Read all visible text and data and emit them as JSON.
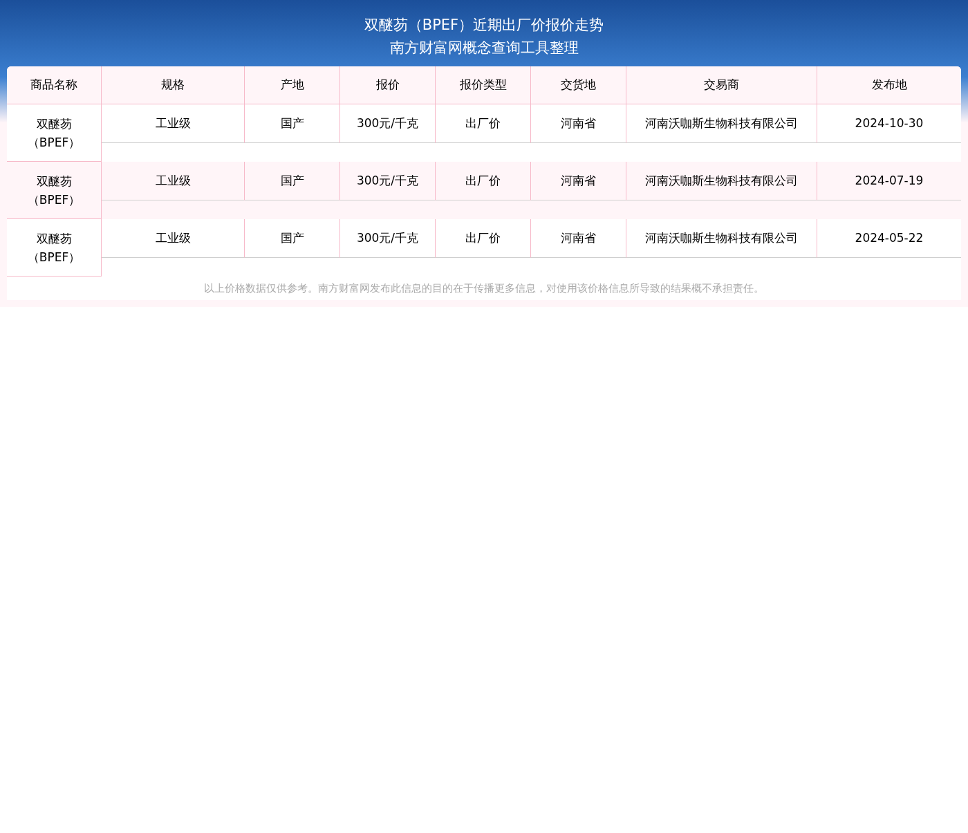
{
  "header": {
    "title": "双醚芴（BPEF）近期出厂价报价走势",
    "subtitle": "南方财富网概念查询工具整理"
  },
  "table": {
    "columns": [
      "商品名称",
      "规格",
      "产地",
      "报价",
      "报价类型",
      "交货地",
      "交易商",
      "发布地"
    ],
    "rows": [
      {
        "cells": [
          "双醚芴（BPEF）",
          "工业级",
          "国产",
          "300元/千克",
          "出厂价",
          "河南省",
          "河南沃咖斯生物科技有限公司",
          "2024-10-30"
        ]
      },
      {
        "cells": [
          "双醚芴（BPEF）",
          "工业级",
          "国产",
          "300元/千克",
          "出厂价",
          "河南省",
          "河南沃咖斯生物科技有限公司",
          "2024-07-19"
        ]
      },
      {
        "cells": [
          "双醚芴（BPEF）",
          "工业级",
          "国产",
          "300元/千克",
          "出厂价",
          "河南省",
          "河南沃咖斯生物科技有限公司",
          "2024-05-22"
        ]
      }
    ]
  },
  "disclaimer": "以上价格数据仅供参考。南方财富网发布此信息的目的在于传播更多信息，对使用该价格信息所导致的结果概不承担责任。"
}
